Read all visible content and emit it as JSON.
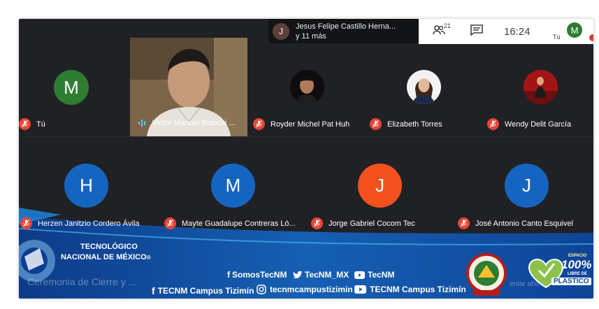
{
  "presenter": {
    "initial": "J",
    "name": "Jesus Felipe Castillo Herna...",
    "more": "y 11 más"
  },
  "topbar": {
    "people_count": "21",
    "time": "16:24",
    "self_label": "Tú",
    "self_initial": "M"
  },
  "participants": [
    {
      "name": "Tú",
      "initial": "M",
      "color": "#2e7d32"
    },
    {
      "name": "Victor Manuel Bianchi ..."
    },
    {
      "name": "Royder Michel Pat Huh"
    },
    {
      "name": "Elizabeth Torres"
    },
    {
      "name": "Wendy Delit García"
    },
    {
      "name": "Herzen Janitzio Cordero Ávila",
      "initial": "H",
      "color": "#1565c0"
    },
    {
      "name": "Mayte Guadalupe Contreras Ló...",
      "initial": "M",
      "color": "#1565c0"
    },
    {
      "name": "Jorge Gabriel Cocom Tec",
      "initial": "J",
      "color": "#f4511e"
    },
    {
      "name": "José Antonio Canto Esquivel",
      "initial": "J",
      "color": "#1565c0"
    }
  ],
  "banner": {
    "line1": "TECNOLÓGICO",
    "line2": "NACIONAL DE MÉXICO",
    "reg": "®",
    "somos": "SomosTecNM",
    "twitter": "TecNM_MX",
    "youtube1": "TecNM",
    "facebook": "TECNM Campus Tizimín",
    "instagram": "tecnmcampustizimin",
    "youtube2": "TECNM Campus Tizimín",
    "ghost_left": "Ceremonia de Cierre y ...",
    "ghost_right": "entar aho",
    "badge1": "ESPACIO",
    "badge2": "100%",
    "badge3": "LIBRE DE",
    "badge4": "PLASTICO"
  }
}
